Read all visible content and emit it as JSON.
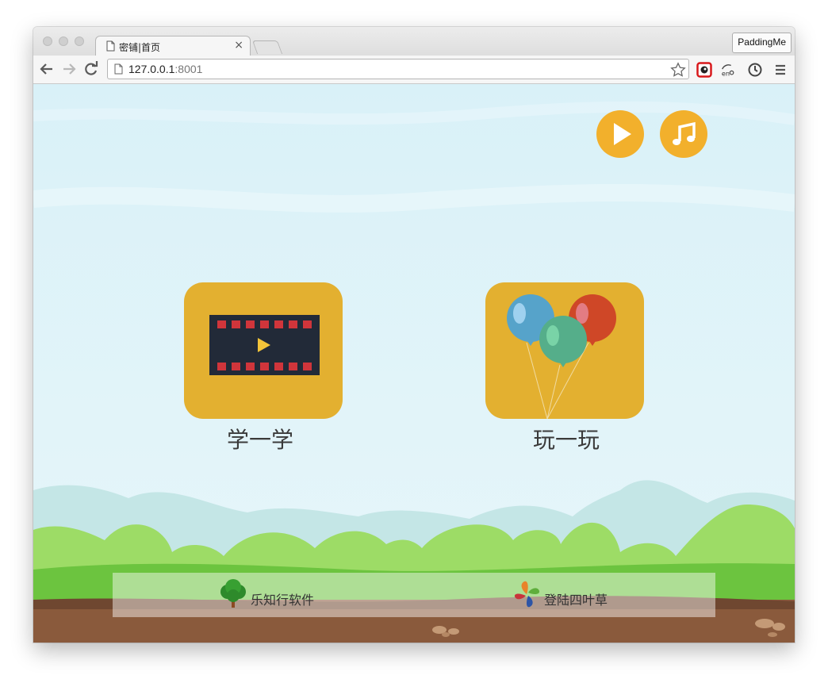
{
  "browser": {
    "tab_title": "密铺|首页",
    "tab_close": "×",
    "profile_button": "PaddingMe",
    "url_host": "127.0.0.1",
    "url_port": ":8001"
  },
  "page": {
    "top_buttons": [
      {
        "icon": "play-icon"
      },
      {
        "icon": "music-note-icon"
      }
    ],
    "tiles": [
      {
        "label": "学一学",
        "icon": "film-strip-icon"
      },
      {
        "label": "玩一玩",
        "icon": "balloons-icon"
      }
    ],
    "footer": {
      "left_label": "乐知行软件",
      "right_label": "登陆四叶草"
    }
  },
  "colors": {
    "tile": "#e3b030",
    "round_button": "#f2b02c",
    "sky": "#dcf2f8",
    "grass": "#8fd45c",
    "soil": "#8a5a3c"
  }
}
